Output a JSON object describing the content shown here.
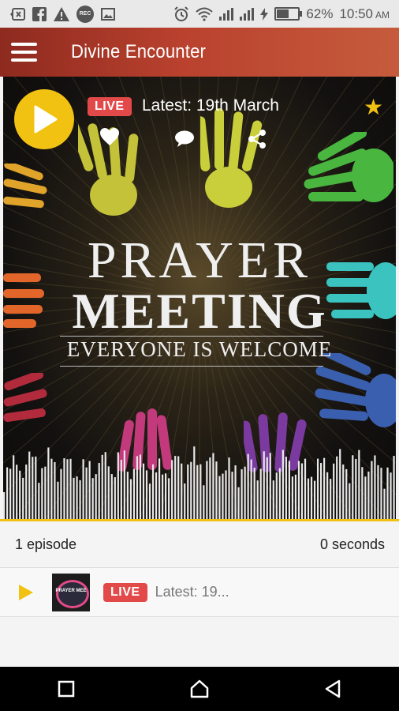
{
  "status_bar": {
    "battery_percent": "62%",
    "time": "10:50",
    "ampm": "AM",
    "battery_level": 0.62,
    "rec_label": "REC",
    "icons": [
      "back-icon",
      "facebook-icon",
      "warning-icon",
      "rec-icon",
      "image-icon",
      "alarm-icon",
      "wifi-icon",
      "signal-icon",
      "signal-icon",
      "charging-icon",
      "battery-icon"
    ]
  },
  "app_bar": {
    "title": "Divine Encounter"
  },
  "player": {
    "live_badge": "LIVE",
    "title": "Latest: 19th March",
    "poster": {
      "line1": "PRAYER",
      "line2": "MEETING",
      "line3": "EVERYONE IS WELCOME"
    },
    "accent_color": "#f2c213",
    "live_color": "#e24a4a"
  },
  "info": {
    "episode_count": "1 episode",
    "duration": "0 seconds"
  },
  "episodes": [
    {
      "live_badge": "LIVE",
      "title": "Latest: 19...",
      "thumb_text": "PRAYER MEE"
    }
  ]
}
